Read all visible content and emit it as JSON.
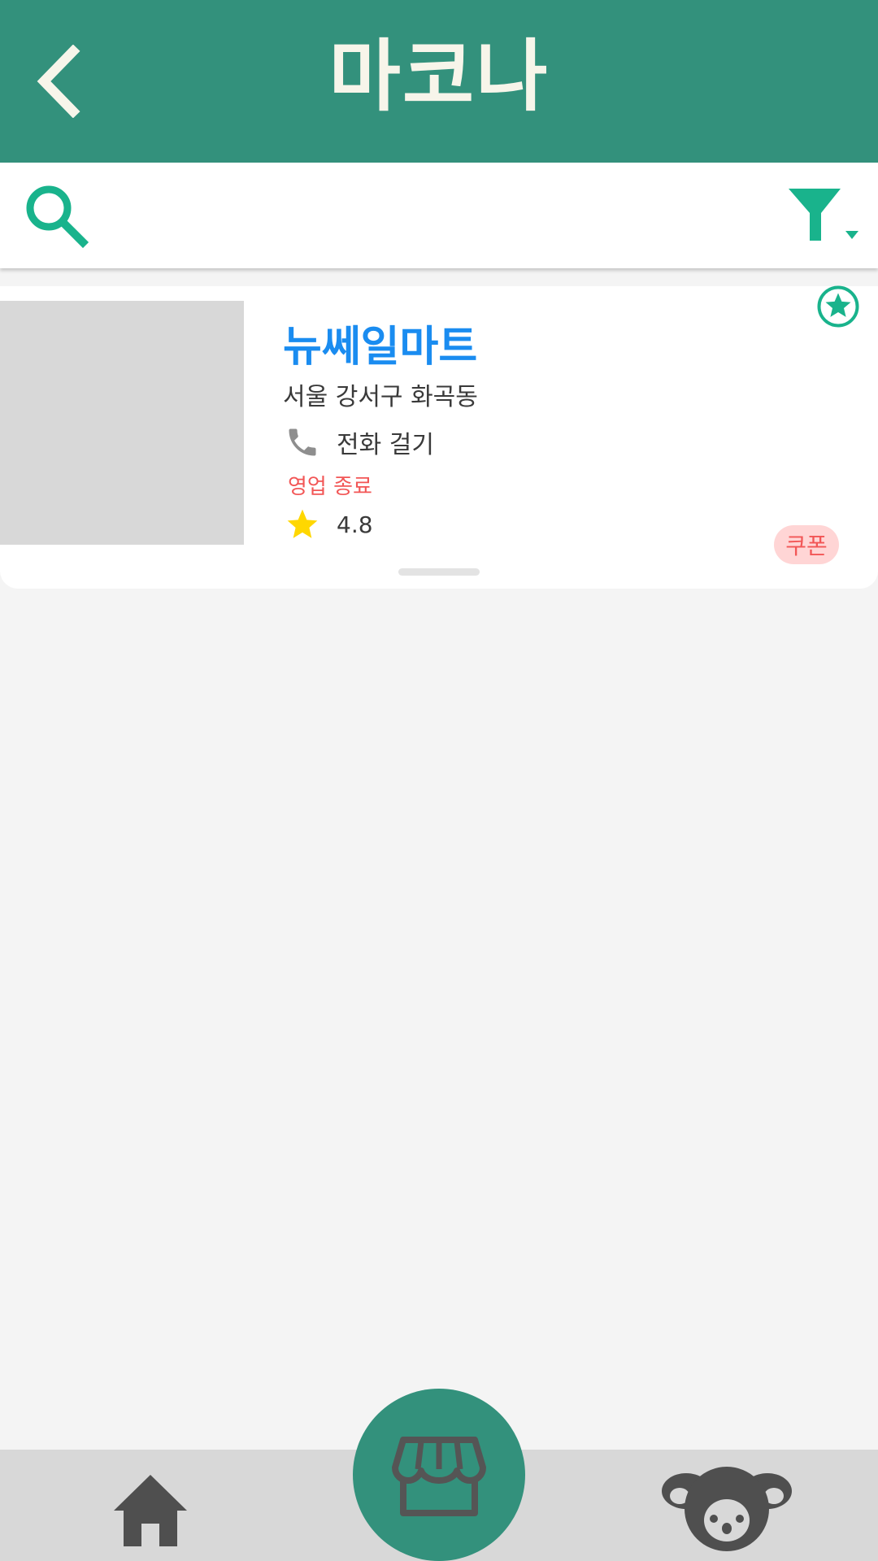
{
  "header": {
    "title": "마코나",
    "back_icon": "chevron-left-icon"
  },
  "search": {
    "placeholder": "",
    "value": "",
    "search_icon": "search-icon",
    "filter_icon": "filter-icon"
  },
  "store": {
    "name": "뉴쎄일마트",
    "address": "서울 강서구 화곡동",
    "call_label": "전화 걸기",
    "status": "영업 종료",
    "rating": "4.8",
    "coupon_label": "쿠폰",
    "favorite_icon": "star-circle-icon"
  },
  "colors": {
    "primary": "#33917c",
    "accent_green": "#19b38c",
    "store_name": "#1a8cf0",
    "status_closed": "#f25656",
    "coupon_bg": "#ffd5d5",
    "rating_star": "#ffd700"
  },
  "bottom_nav": {
    "items": [
      {
        "icon": "home-icon"
      },
      {
        "icon": "store-icon",
        "active": true
      },
      {
        "icon": "koala-icon"
      }
    ]
  }
}
